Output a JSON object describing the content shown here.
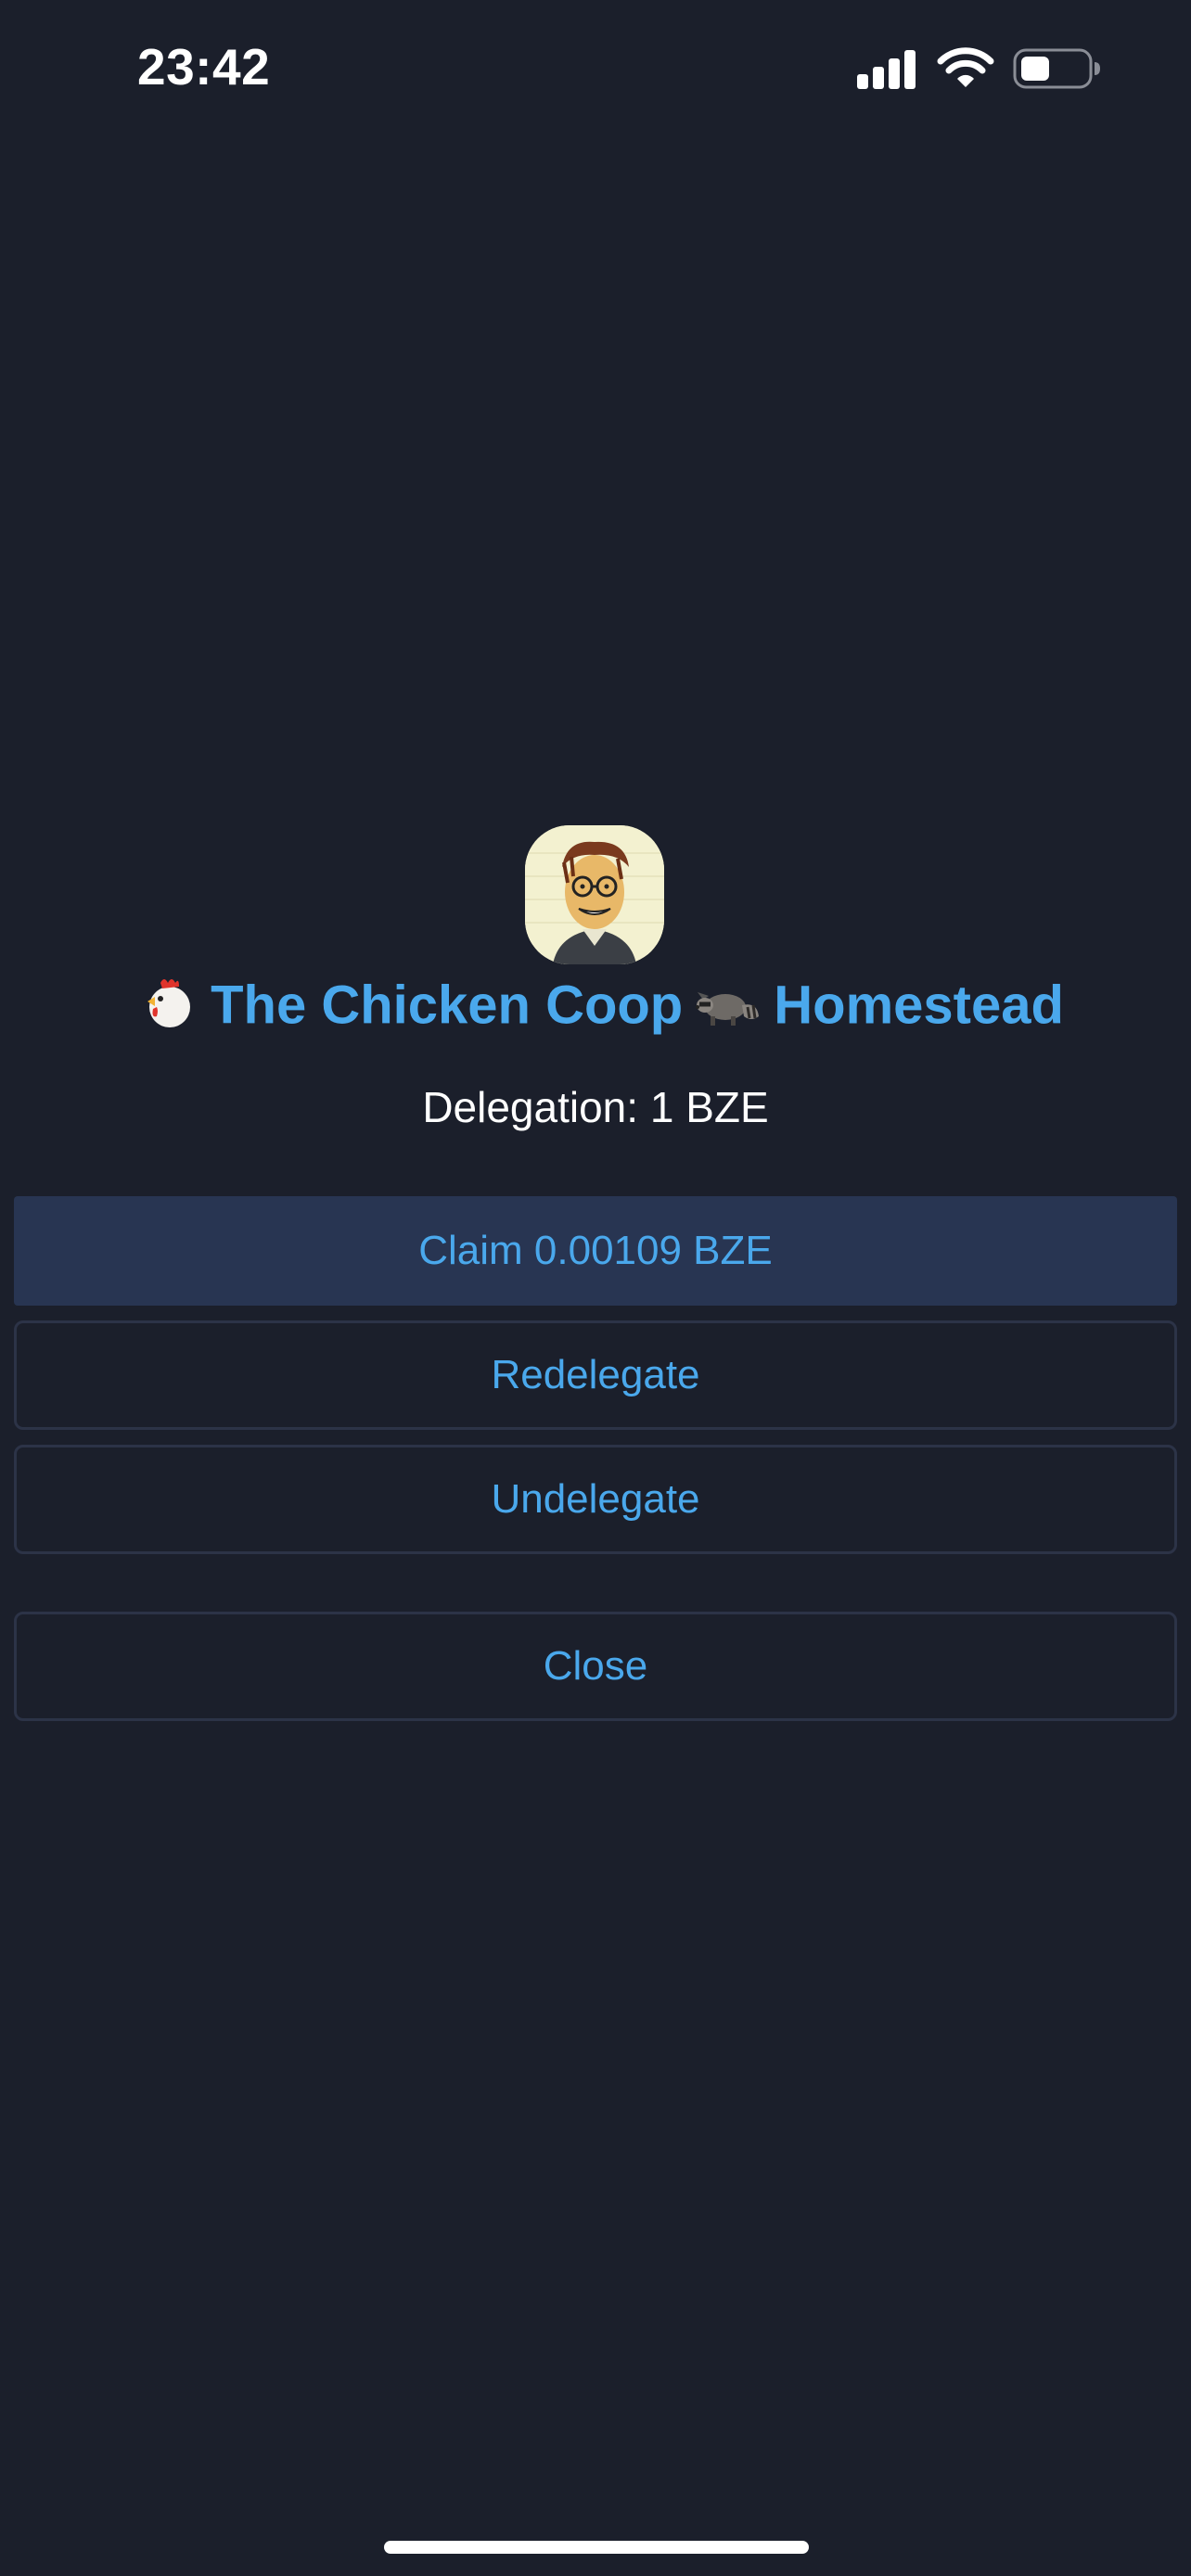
{
  "status_bar": {
    "time": "23:42",
    "icons": [
      "signal-icon",
      "wifi-icon",
      "battery-icon"
    ]
  },
  "validator": {
    "name_prefix_emoji": "chicken-emoji",
    "name_part1": "The Chicken Coop",
    "name_mid_emoji": "raccoon-emoji",
    "name_part2": "Homestead",
    "avatar": "cartoon-portrait-avatar"
  },
  "delegation": {
    "text": "Delegation: 1 BZE"
  },
  "actions": {
    "claim_label": "Claim 0.00109 BZE",
    "redelegate_label": "Redelegate",
    "undelegate_label": "Undelegate",
    "close_label": "Close"
  },
  "colors": {
    "background": "#1b1f2b",
    "accent": "#4aa8ec",
    "primary_button_bg": "#283552",
    "button_border": "#2c3347"
  }
}
